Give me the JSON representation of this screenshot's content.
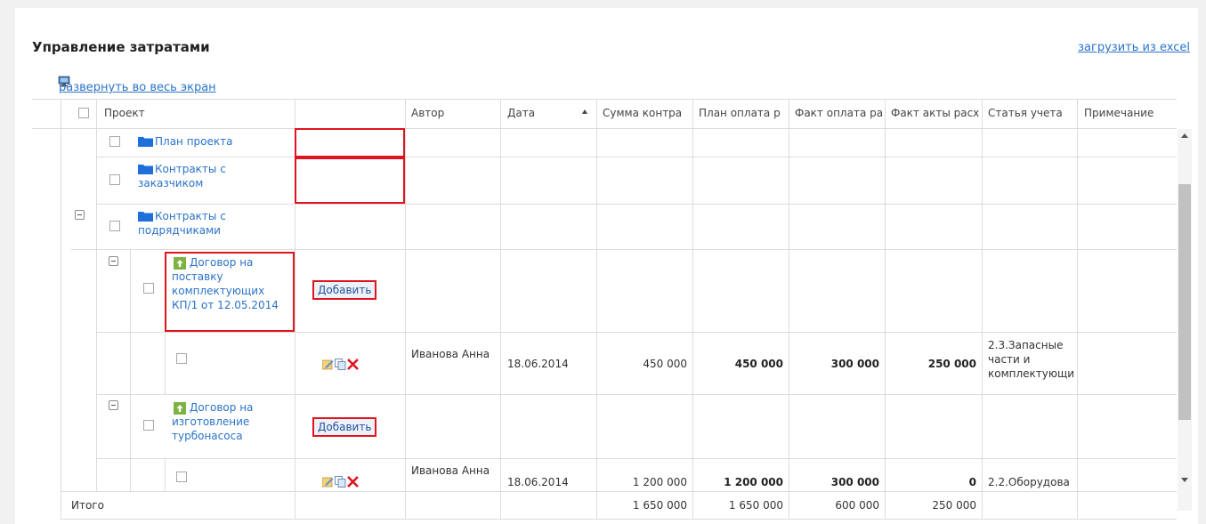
{
  "page": {
    "title": "Управление затратами",
    "excel_link": "загрузить из excel",
    "expand_link": "развернуть во весь экран"
  },
  "header": {
    "project": "Проект",
    "author": "Автор",
    "date": "Дата",
    "contract_sum": "Сумма контра",
    "plan_payment": "План оплата р",
    "fact_payment": "Факт оплата ра",
    "fact_acts": "Факт акты расх",
    "account_item": "Статья учета",
    "note": "Примечание"
  },
  "rows": [
    {
      "label": "План проекта",
      "type": "folder"
    },
    {
      "label": "Контракты с заказчиком",
      "type": "folder"
    },
    {
      "label": "Контракты с подрядчиками",
      "type": "folder"
    },
    {
      "label": "Договор на поставку комплектующих КП/1 от 12.05.2014",
      "type": "contract",
      "button": "Добавить"
    },
    {
      "type": "entry",
      "author": "Иванова Анна",
      "date": "18.06.2014",
      "contract_sum": "450 000",
      "plan_payment": "450 000",
      "fact_payment": "300 000",
      "fact_acts": "250 000",
      "account_item": "2.3.Запасные части и комплектующи"
    },
    {
      "label": "Договор на изготовление турбонасоса",
      "type": "contract",
      "button": "Добавить"
    },
    {
      "type": "entry",
      "author": "Иванова Анна",
      "date": "18.06.2014",
      "contract_sum": "1 200 000",
      "plan_payment": "1 200 000",
      "fact_payment": "300 000",
      "fact_acts": "0",
      "account_item": "2.2.Оборудова"
    }
  ],
  "total": {
    "label": "Итого",
    "contract_sum": "1 650 000",
    "plan_payment": "1 650 000",
    "fact_payment": "600 000",
    "fact_acts": "250 000"
  },
  "colors": {
    "link": "#2a73c9",
    "highlight": "#e0141e",
    "folder": "#1e6fd9",
    "contract_icon": "#7cb342"
  },
  "icons": [
    "monitor-icon",
    "folder-icon",
    "document-upload-icon",
    "edit-icon",
    "copy-icon",
    "delete-icon",
    "sort-ascending-icon"
  ]
}
